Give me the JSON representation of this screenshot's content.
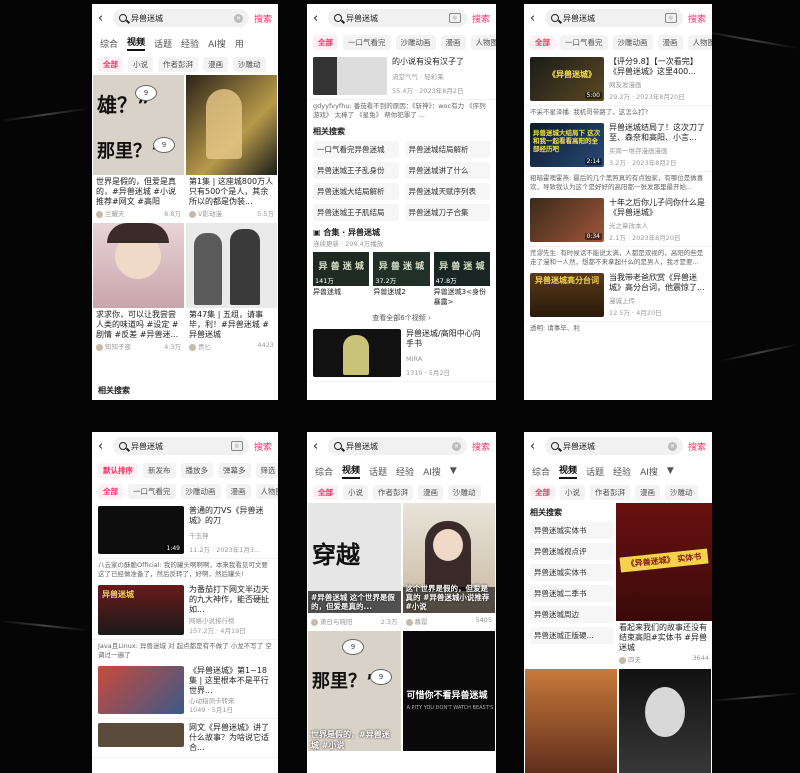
{
  "query": "异兽迷城",
  "search_button": "搜索",
  "top_tabs": [
    "综合",
    "视频",
    "话题",
    "经验",
    "AI搜",
    "用"
  ],
  "sub_chips": [
    "全部",
    "小说",
    "作者彭湃",
    "漫画",
    "沙雕动"
  ],
  "sort_chips": [
    "全部",
    "一口气看完",
    "沙雕动画",
    "漫画",
    "人物图"
  ],
  "sort_tabs": [
    "默认排序",
    "新发布",
    "播放多",
    "弹幕多",
    "筛选"
  ],
  "related_label": "相关搜索",
  "p1": {
    "cards": [
      {
        "title": "世界是假的，但爱是真的，#异兽迷城 #小说推荐#网文 #高阳",
        "author": "兰耀天",
        "likes": "8.8万",
        "overlay": "雄？” 那里？”"
      },
      {
        "title": "第1集 | 这座城800万人只有500个是人，其余所以的都是伪装...",
        "author": "V影动漫",
        "likes": "5.5万"
      },
      {
        "title": "求求你，可以让我尝尝人类的味道吗 #设定 #剧情 #反差 #异兽迷...",
        "author": "知知子夜",
        "likes": "4.3万"
      },
      {
        "title": "第47集 | 五组，请事毕，利！#异兽迷城 #异兽迷城",
        "author": "贡匕",
        "likes": "4423"
      }
    ]
  },
  "p2": {
    "top_row": {
      "title": "的小说有没有汉子了",
      "meta": "流堂气气 · 轻彩莱",
      "stats": "55.4万 · 2023年8月2日"
    },
    "comment": "gdyyfvyfhu: 番茄看不到的原因：《斩神》：woc有力 《序列游戏》 太棒了 《星兔》 帮你犯罪了 ...",
    "related": [
      "一口气看完异兽迷城",
      "异兽迷城结局解析",
      "异兽迷城王子乱身份",
      "异兽迷城讲了什么",
      "异兽迷城大结局解析",
      "异兽迷城天赋序列表",
      "异兽迷城王子肌结局",
      "异兽迷城刀子合集"
    ],
    "collection_label": "合集 · 异兽迷城",
    "collection_meta": "连续更新 · 299.4万播放",
    "collection_items": [
      {
        "title": "异兽迷城",
        "views": "141万",
        "cover": "异 兽 迷 城"
      },
      {
        "title": "异兽迷城2",
        "views": "37.2万",
        "cover": "异 兽 迷 城"
      },
      {
        "title": "异兽迷城3<身份暴露>",
        "views": "47.8万",
        "cover": "异 兽 迷 城"
      }
    ],
    "view_all": "查看全部6个视频",
    "bottom": {
      "title": "异兽迷城/高阳中心向 手书",
      "author": "MIRA",
      "stats": "1310 · 5月2日"
    }
  },
  "p3": {
    "rows": [
      {
        "title": "【评分9.8】【一次看完】《异兽迷城》这里400...",
        "tag": "《异兽迷城》",
        "author": "网友发漫画",
        "stats": "29.2万 · 2023年8月20日",
        "dur": "5:00"
      },
      {
        "comment": "不采不星泽播: 我机哥带路了，这怎么打?"
      },
      {
        "title": "异兽迷城结局了！这次刀了至、森奈和高阳、小言...",
        "tag": "异兽迷城大结局下 这次和我一起看看高阳的全部经历吧",
        "author": "买周一堆存漫画漫画",
        "stats": "3.2万 · 2023年8月2日",
        "dur": "2:14"
      },
      {
        "comment": "粗暗霍噢霍燕: 最后的几个黑照真的有点独家，有哪位是做喜欢，导致我认为这个是好好的高阳都一张发那里最开始..."
      },
      {
        "title": "十年之后你儿子问你什么是《异兽迷城》",
        "author": "光之章改本人",
        "stats": "2.1万 · 2023年8月20日",
        "dur": "0:34"
      },
      {
        "comment": "荒谬先生: 有时候话不能说太满，人都是双视的，高阳的些是走了漫和一人然，想都不来拿起什么的是男人，我才是要..."
      },
      {
        "title": "当我带老爸欣赏《异兽迷城》高分台词，他震惊了...",
        "tag": "异兽迷城高分台词",
        "author": "漫诚上传",
        "stats": "12.5万 · 4月20日"
      },
      {
        "comment": "透明: 请事毕、利"
      }
    ]
  },
  "p4": {
    "rows": [
      {
        "title": "普通的刀VS《异兽迷城》的刀",
        "author": "千玉神",
        "stats": "11.2万 · 2023年1月3...",
        "dur": "1:49"
      },
      {
        "comment": "八云家の酥脆Official: 我的罐头啊啊啊，本来我看见可文要这了已经做准备了，然后反转了，好啊，然后罐头!"
      },
      {
        "title": "为番茄打下网文半边天的九大神作，能否硬扯如...",
        "tag": "异兽迷城",
        "author": "网络小说排行榜",
        "stats": "157.2万 · 4月19日"
      },
      {
        "comment": "Java且Linux: 异兽迷城 对 起点都是有不做了 小龙不写了 空调过一遍了"
      },
      {
        "title": "《异兽迷城》第1~18集 | 这里根本不是平行世界...",
        "author": "心动指测卡转来",
        "stats": "1049 · 5月1日"
      },
      {
        "title": "网文《异兽迷城》讲了什么故事？为啥说它适合..."
      }
    ]
  },
  "p5": {
    "cards": [
      {
        "title": "#异兽迷城 这个世界是假的，但爱是真的...",
        "author": "萧日与晓阳",
        "likes": "2.3万",
        "big": "穿越"
      },
      {
        "title": "这个世界是假的，但爱是真的 #异兽迷城小说推荐 #小说",
        "author": "慕罂",
        "likes": "5405"
      },
      {
        "title": "世界是假的，#异兽迷城 #小说",
        "big": "那里？”"
      },
      {
        "title": "可惜你不看异兽迷城",
        "sub": "A PITY YOU DON'T WATCH BEAST'S"
      }
    ]
  },
  "p6": {
    "related": [
      "异兽迷城实体书",
      "异兽迷城视点评",
      "异兽迷城实体书",
      "异兽迷城二季书",
      "异兽迷城周边",
      "异兽迷城正版硬..."
    ],
    "cards": [
      {
        "title": "看起来我们的故事还没有结束高阳#实体书 #异兽迷城",
        "author": "四夫",
        "likes": "3644",
        "overlay": "《异兽迷城》 实体书"
      }
    ]
  },
  "colors": {
    "accent": "#ff2e63",
    "background": "#050505",
    "panel": "#ffffff"
  }
}
